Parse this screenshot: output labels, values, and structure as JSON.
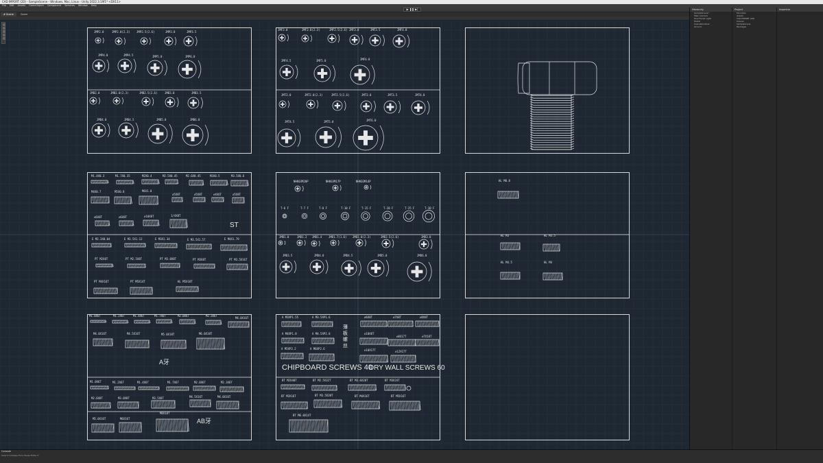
{
  "window": {
    "title": "CAD IMPORT (2D) - SampleScene - Windows, Mac, Linux - Unity 2022.3.19f1* <DX11>"
  },
  "menu": [
    "File",
    "Edit",
    "Assets",
    "GameObject",
    "Component",
    "Services",
    "Window",
    "Help"
  ],
  "tabs": {
    "scene": "# Scene",
    "game": "Game"
  },
  "play": "▶ ❚❚ ▶|",
  "panels": {
    "hierarchy": {
      "title": "Hierarchy",
      "items": [
        "SampleScene*",
        "Main Camera",
        "Directional Light",
        "Model",
        "SceneRenderer",
        "Ground"
      ]
    },
    "project": {
      "title": "Project",
      "items": [
        "Favorites",
        "Assets",
        "CAD IMPORT (2D)",
        "Scenes",
        "SampleScene",
        "Packages"
      ]
    },
    "inspector": {
      "title": "Inspector"
    },
    "layers": "Layers",
    "layout": "Layout"
  },
  "console": {
    "tab": "Console",
    "lines": [
      "Clear ▾  Collapse  Error Pause  Editor ▾"
    ]
  },
  "sheet1_top": {
    "labels": [
      "JMP2.0",
      "JMP2.0(2.3)",
      "JMP2.5(2.6)",
      "JMP3.0",
      "JMP3.5",
      "JMP4.0",
      "JMP4.5",
      "JMP5.0",
      "JMP6.0"
    ]
  },
  "sheet1_bot": {
    "labels": [
      "JMB2.0",
      "JMB2.0(2.3)",
      "JMB2.5(2.6)",
      "JMB3.0",
      "JMB3.5",
      "JMB4.0",
      "JMB4.5",
      "JMB5.0",
      "JMB6.0"
    ]
  },
  "sheet2_top": {
    "labels": [
      "JMF2.0",
      "JMF2.0(2.3)",
      "JMF2.5(2.6)",
      "JMF3.0",
      "JMF3.5",
      "JMF4.0",
      "JMF4.5",
      "JMF5.0",
      "JMF6.0"
    ]
  },
  "sheet2_bot": {
    "labels": [
      "JMT2.0",
      "JMT2.0(2.3)",
      "JMT2.5(2.6)",
      "JMT3.0",
      "JMT3.5",
      "JMT4.0",
      "JMT4.5",
      "JMT5.0",
      "JMT6.0"
    ]
  },
  "sheet4_top": {
    "labels": [
      "M1.4X0.3",
      "M1.7X0.35",
      "M2X0.4",
      "M2.5X0.45",
      "M2.6X0.45",
      "M3X0.5",
      "M3.5X0.6",
      "M4X0.7",
      "M5X0.8",
      "M6X1.0",
      "⌀5X8T",
      "⌀5X8T",
      "⌀4X6T",
      "⌀5X8T",
      "⌀6X8T",
      "⌀6X8T",
      "⌀10X8T",
      "1/4X8T"
    ],
    "st": "ST"
  },
  "sheet4_bot": {
    "labels": [
      "E M2.3X0.04",
      "E M2.5X1.12",
      "E M3X1.34",
      "E M3.5X1.57",
      "E M4X1.79",
      "PT M2X8T",
      "PT M2.5X8T",
      "PT M3.0X8T",
      "PT M3X8T",
      "PT M3.5X16T",
      "PT M4X16T",
      "PT M5X14T",
      "HL M5X18T"
    ]
  },
  "sheet5_top": {
    "labels": [
      "NHK03M20P",
      "NHK03M17P",
      "NHK03M14P",
      "T-6 F",
      "T-7 F",
      "T-8 F",
      "T-10 F",
      "T-15 F",
      "T-20 F",
      "T-25 F",
      "T-30 F"
    ]
  },
  "sheet5_bot": {
    "labels": [
      "JMD1.0",
      "JMD1.2",
      "JMD1.4",
      "JMD1.7(1.6)",
      "JMD2.0(2.3)",
      "JMD2.5(2.6)",
      "JMD3.0",
      "JMD3.5",
      "JMD4.0",
      "JMD4.5",
      "JMD5.0",
      "JMD6.0"
    ]
  },
  "sheet6_top": {
    "labels": [
      "HL M0.8"
    ]
  },
  "sheet6_bot": {
    "labels": [
      "HL M3",
      "HL M3.5",
      "HL M4.5",
      "HL M4"
    ]
  },
  "sheet7_top": {
    "labels": [
      "M1.0X6T",
      "M1.2X6T",
      "M1.4X6T",
      "M1.7X6T",
      "M2.0X6T",
      "M2.3X6T",
      "M4.0X16T",
      "M4.5X16T",
      "M5.0X18T",
      "M6.0X18T"
    ],
    "big": "A牙"
  },
  "sheet7_bot": {
    "labels": [
      "M1.0X6T",
      "M1.2X6T",
      "M1.4X6T",
      "M1.7X6T",
      "M2.0X6T",
      "M2.3X6T",
      "M2.6X8T",
      "M3.0X8T",
      "M3.5X8T",
      "M4.5X16T",
      "M4.0X16T",
      "M5.0X16T",
      "M6X16T",
      "M8X18T"
    ],
    "big": "AB牙"
  },
  "sheet8": {
    "labels": [
      "A M3XP1.55",
      "A M3.5XP1.6",
      "A M4XP1.8",
      "A M4.5XP2.0",
      "A M5XP2.2",
      "A M6XP2.6",
      "⌀6X8T",
      "⌀7X8T",
      "⌀8X8T",
      "⌀10X8T",
      "⌀8X17T",
      "⌀7X18T",
      "⌀10X17T",
      "⌀12X17T",
      "BT M2X40T",
      "BT M2.5X32T",
      "BT M3.6X28T",
      "BT M3X24T",
      "BT M3X16T",
      "BT M3.5X20T",
      "BT M4X16T",
      "BT M5X16T",
      "BT M6.0X14T"
    ],
    "vertical": "薄板螺丝",
    "chip": "CHIPBOARD SCREWS 40",
    "dry": "DRY WALL SCREWS 60"
  }
}
